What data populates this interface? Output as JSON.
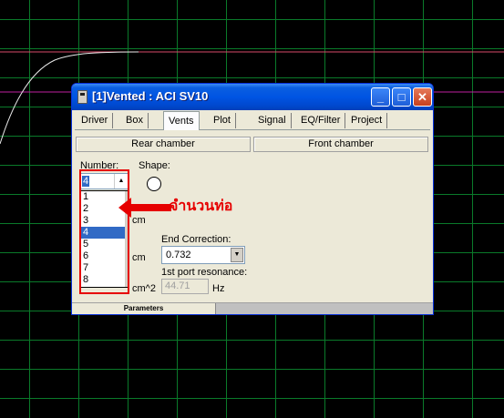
{
  "window": {
    "title": "[1]Vented : ACI SV10",
    "min_glyph": "_",
    "max_glyph": "□",
    "close_glyph": "✕"
  },
  "tabs": [
    {
      "label": "Driver"
    },
    {
      "label": "Box"
    },
    {
      "label": "Vents"
    },
    {
      "label": "Plot"
    },
    {
      "label": "Signal"
    },
    {
      "label": "EQ/Filter"
    },
    {
      "label": "Project"
    }
  ],
  "active_tab": "Vents",
  "rear_chamber": {
    "header": "Rear chamber",
    "number_label": "Number:",
    "number_value": "4",
    "shape_label": "Shape:",
    "number_options": [
      "1",
      "2",
      "3",
      "4",
      "5",
      "6",
      "7",
      "8"
    ],
    "selected_option": "4",
    "end_correction_label": "End Correction:",
    "end_correction_value": "0.732",
    "first_port_resonance_label": "1st port resonance:",
    "first_port_resonance_value": "44.71",
    "unit_cm_1": "cm",
    "unit_cm_2": "cm",
    "unit_cm2": "cm^2",
    "unit_hz": "Hz"
  },
  "front_chamber": {
    "header": "Front chamber"
  },
  "statusbar": {
    "tab_label": "Parameters"
  },
  "annotation": {
    "text": "จำนวนท่อ",
    "color": "#e60000"
  },
  "colors": {
    "grid": "#0a7a2a",
    "titlebar": "#0054e3",
    "window_bg": "#ece9d8",
    "selection": "#316ac5"
  }
}
